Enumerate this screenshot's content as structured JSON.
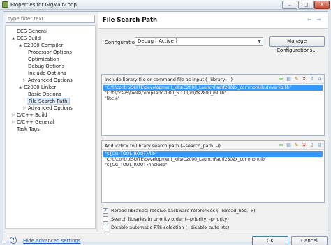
{
  "window": {
    "title": "Properties for GigMainLoop",
    "minimize": "–",
    "maximize": "□",
    "close": "✕"
  },
  "tree": {
    "filter_placeholder": "type filter text",
    "items": [
      {
        "label": "CCS General",
        "level": 0,
        "twisty": ""
      },
      {
        "label": "CCS Build",
        "level": 0,
        "twisty": "▲"
      },
      {
        "label": "C2000 Compiler",
        "level": 1,
        "twisty": "▲"
      },
      {
        "label": "Processor Options",
        "level": 2,
        "twisty": ""
      },
      {
        "label": "Optimization",
        "level": 2,
        "twisty": ""
      },
      {
        "label": "Debug Options",
        "level": 2,
        "twisty": ""
      },
      {
        "label": "Include Options",
        "level": 2,
        "twisty": ""
      },
      {
        "label": "Advanced Options",
        "level": 2,
        "twisty": "▷"
      },
      {
        "label": "C2000 Linker",
        "level": 1,
        "twisty": "▲"
      },
      {
        "label": "Basic Options",
        "level": 2,
        "twisty": ""
      },
      {
        "label": "File Search Path",
        "level": 2,
        "twisty": "",
        "selected": true
      },
      {
        "label": "Advanced Options",
        "level": 2,
        "twisty": "▷"
      },
      {
        "label": "C/C++ Build",
        "level": 0,
        "twisty": "▷"
      },
      {
        "label": "C/C++ General",
        "level": 0,
        "twisty": "▷"
      },
      {
        "label": "Task Tags",
        "level": 0,
        "twisty": ""
      }
    ]
  },
  "page": {
    "title": "File Search Path",
    "back": "⇦",
    "forward": "⇨",
    "configuration_label": "Configuration:",
    "configuration_value": "Debug  [ Active ]",
    "manage_button": "Manage Configurations..."
  },
  "library_box": {
    "label": "Include library file or command file as input (--library, -l)",
    "entries": [
      "\"C:\\ti\\controlSUITE\\development_kits\\C2000_LaunchPad\\f2802x_common\\lib\\driverlib.lib\"",
      "\"C:\\ti\\ccsv5\\tools\\compiler\\c2000_6.1.0\\lib\\rts2800_ml.lib\"",
      "\"libc.a\""
    ]
  },
  "search_box": {
    "label": "Add <dir> to library search path (--search_path, -i)",
    "entries": [
      "\"${CG_TOOL_ROOT}/lib\"",
      "\"C:\\ti\\controlSUITE\\development_kits\\C2000_LaunchPad\\f2802x_common\\lib\"",
      "\"${CG_TOOL_ROOT}/include\""
    ]
  },
  "options": [
    {
      "label": "Reread libraries; resolve backward references (--reread_libs, -x)",
      "checked": true
    },
    {
      "label": "Search libraries in priority order (--priority, -priority)",
      "checked": false
    },
    {
      "label": "Disable automatic RTS selection (--disable_auto_rts)",
      "checked": false
    }
  ],
  "footer": {
    "help": "?",
    "advanced_link": "Hide advanced settings",
    "ok": "OK",
    "cancel": "Cancel"
  }
}
